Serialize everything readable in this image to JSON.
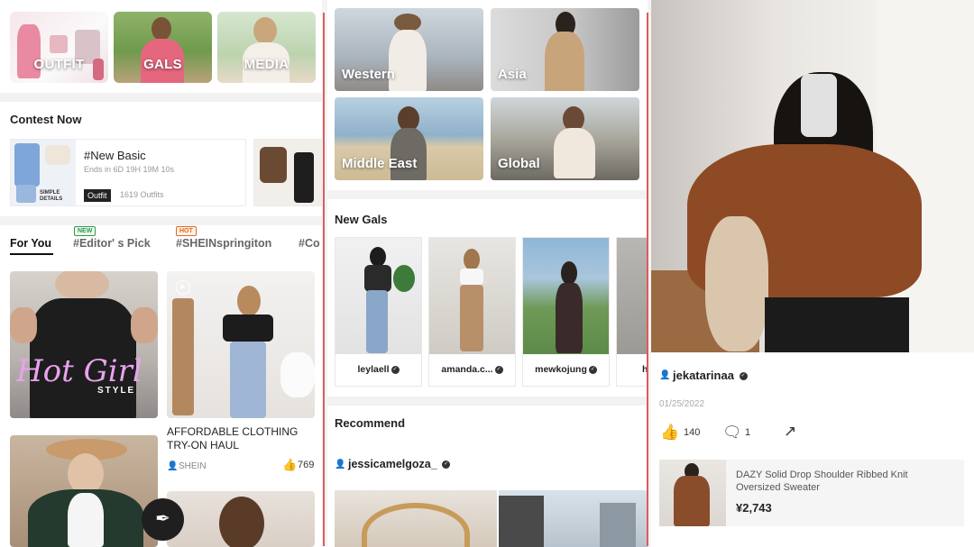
{
  "home": {
    "categories": [
      {
        "label": "OUTFIT"
      },
      {
        "label": "GALS"
      },
      {
        "label": "MEDIA"
      }
    ],
    "contest": {
      "section_title": "Contest Now",
      "name": "#New Basic",
      "ends": "Ends in 6D 19H 19M 10s",
      "tag": "Outfit",
      "count": "1619 Outfits",
      "thumb_caption": "SIMPLE DETAILS"
    },
    "tabs": [
      {
        "label": "For You"
      },
      {
        "label": "#Editor' s Pick",
        "badge": "NEW"
      },
      {
        "label": "#SHEINspringiton",
        "badge": "HOT"
      },
      {
        "label": "#Co"
      }
    ],
    "feed": {
      "overlay_text": "Hot Girl",
      "overlay_subtext": "STYLE",
      "post_title": "AFFORDABLE CLOTHING TRY-ON HAUL",
      "post_author": "SHEIN",
      "post_likes": "769"
    }
  },
  "gals": {
    "regions": [
      {
        "label": "Western"
      },
      {
        "label": "Asia"
      },
      {
        "label": "Middle East"
      },
      {
        "label": "Global"
      }
    ],
    "new_gals_title": "New Gals",
    "new_gals": [
      {
        "name": "leylaell"
      },
      {
        "name": "amanda.c..."
      },
      {
        "name": "mewkojung"
      },
      {
        "name": "h"
      }
    ],
    "recommend_title": "Recommend",
    "recommend_user": "jessicamelgoza_"
  },
  "post": {
    "author": "jekatarinaa",
    "date": "01/25/2022",
    "likes": "140",
    "comments": "1",
    "product": {
      "name": "DAZY Solid Drop Shoulder Ribbed Knit Oversized Sweater",
      "price": "¥2,743"
    }
  },
  "icons": {
    "person": "person-icon",
    "thumb": "thumbs-up-icon",
    "comment": "comment-icon",
    "share": "share-icon",
    "verified": "verified-badge-icon",
    "brush": "brush-icon",
    "play": "play-icon"
  },
  "colors": {
    "divider": "#e05a5a",
    "new_badge": "#2e9a4f",
    "hot_badge": "#e06a20"
  }
}
